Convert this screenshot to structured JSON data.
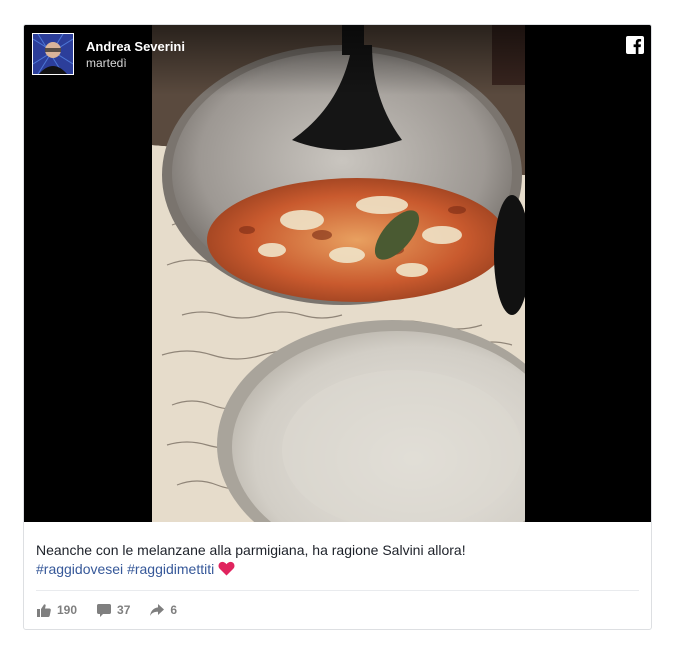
{
  "post": {
    "author_name": "Andrea Severini",
    "date": "martedì",
    "caption_text": "Neanche con le melanzane alla parmigiana, ha ragione Salvini allora!",
    "hashtags": [
      "#raggidovesei",
      "#raggidimettiti"
    ],
    "emoji": "❤️",
    "stats": {
      "likes": "190",
      "comments": "37",
      "shares": "6"
    }
  },
  "colors": {
    "facebook_blue": "#365899",
    "card_border": "#dddfe2",
    "text": "#1d2129",
    "stat_grey": "#7f7f7f",
    "heart_red": "#e0245e"
  },
  "icons": {
    "brand": "facebook-icon",
    "like": "thumbs-up-icon",
    "comment": "comment-icon",
    "share": "share-arrow-icon"
  }
}
